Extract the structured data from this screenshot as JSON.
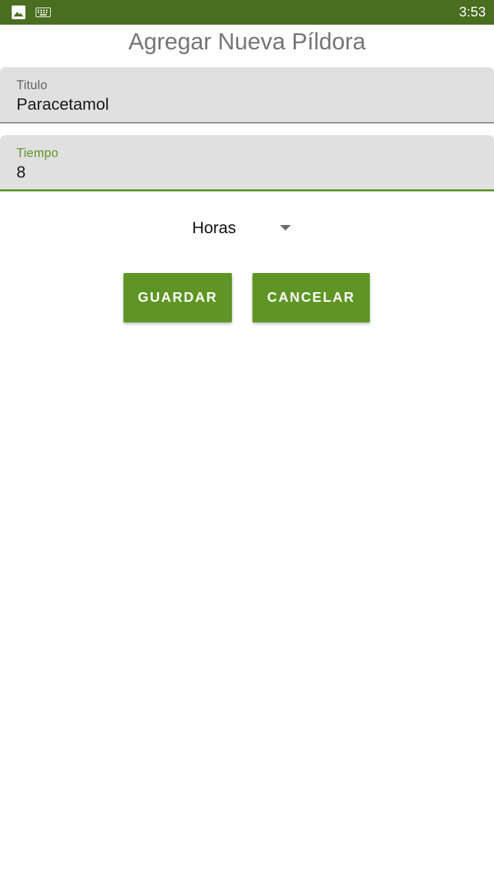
{
  "status_bar": {
    "time": "3:53",
    "icons": [
      "image-icon",
      "keyboard-icon"
    ],
    "background": "#4a6e1f"
  },
  "page": {
    "title": "Agregar Nueva Píldora"
  },
  "form": {
    "titulo": {
      "label": "Titulo",
      "value": "Paracetamol"
    },
    "tiempo": {
      "label": "Tiempo",
      "value": "8"
    },
    "unit_select": {
      "selected": "Horas"
    }
  },
  "actions": {
    "save_label": "GUARDAR",
    "cancel_label": "CANCELAR"
  },
  "colors": {
    "accent": "#5f9524",
    "field_background": "#e0e0e0",
    "title_text": "#757575"
  }
}
